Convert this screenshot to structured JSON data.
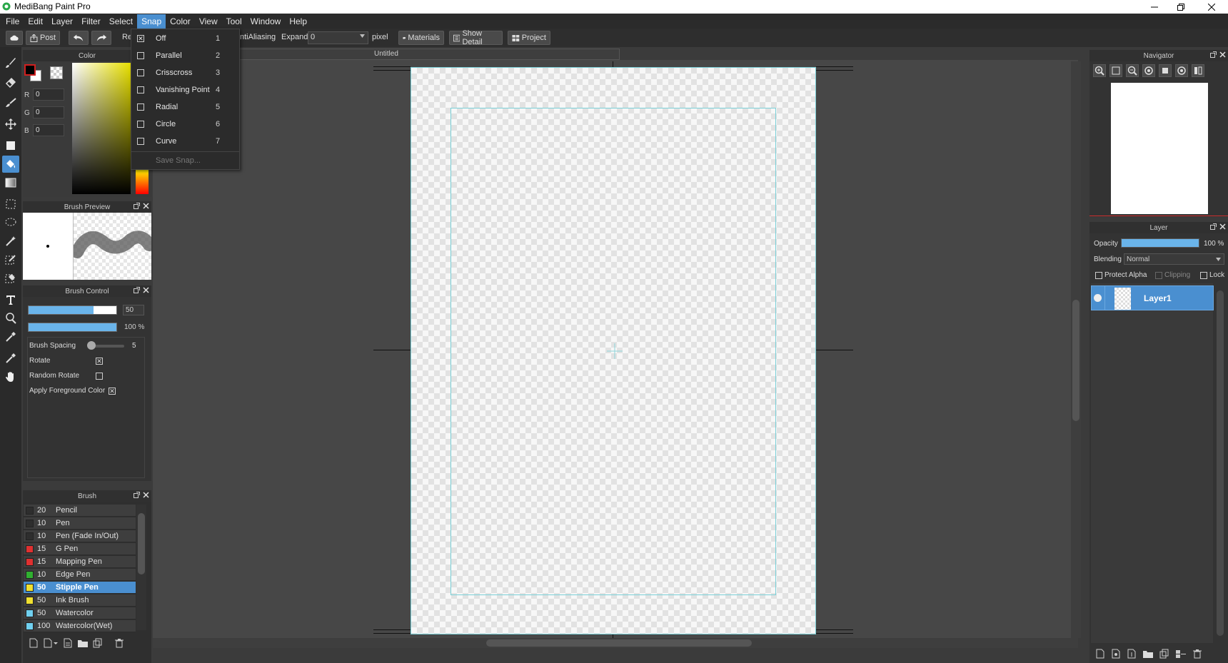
{
  "window": {
    "title": "MediBang Paint Pro"
  },
  "menubar": {
    "items": [
      "File",
      "Edit",
      "Layer",
      "Filter",
      "Select",
      "Snap",
      "Color",
      "View",
      "Tool",
      "Window",
      "Help"
    ],
    "active": "Snap"
  },
  "toolbar": {
    "post_label": "Post",
    "partial_label": "Re",
    "antialias_label": "ntiAliasing",
    "expand_label": "Expand",
    "expand_value": "0",
    "unit_label": "pixel",
    "materials_label": "Materials",
    "show_detail_label": "Show Detail",
    "project_label": "Project"
  },
  "snap_menu": {
    "items": [
      {
        "label": "Off",
        "key": "1",
        "checked": true
      },
      {
        "label": "Parallel",
        "key": "2",
        "checked": false
      },
      {
        "label": "Crisscross",
        "key": "3",
        "checked": false
      },
      {
        "label": "Vanishing Point",
        "key": "4",
        "checked": false
      },
      {
        "label": "Radial",
        "key": "5",
        "checked": false
      },
      {
        "label": "Circle",
        "key": "6",
        "checked": false
      },
      {
        "label": "Curve",
        "key": "7",
        "checked": false
      }
    ],
    "save_label": "Save Snap..."
  },
  "color_panel": {
    "title": "Color",
    "r_label": "R",
    "r_value": "0",
    "g_label": "G",
    "g_value": "0",
    "b_label": "B",
    "b_value": "0",
    "hue_color": "#e8e000"
  },
  "brush_preview": {
    "title": "Brush Preview"
  },
  "brush_control": {
    "title": "Brush Control",
    "size_value": "50",
    "size_fraction": 0.74,
    "opacity_value": "100 %",
    "opacity_fraction": 1.0,
    "spacing_label": "Brush Spacing",
    "spacing_value": "5",
    "rotate_label": "Rotate",
    "rotate_checked": true,
    "random_rotate_label": "Random Rotate",
    "random_rotate_checked": false,
    "apply_fg_label": "Apply Foreground Color",
    "apply_fg_checked": true
  },
  "brush_panel": {
    "title": "Brush",
    "items": [
      {
        "size": "20",
        "name": "Pencil",
        "color": "#2e2e2e"
      },
      {
        "size": "10",
        "name": "Pen",
        "color": "#2e2e2e"
      },
      {
        "size": "10",
        "name": "Pen (Fade In/Out)",
        "color": "#2e2e2e"
      },
      {
        "size": "15",
        "name": "G Pen",
        "color": "#e03030"
      },
      {
        "size": "15",
        "name": "Mapping Pen",
        "color": "#e03030"
      },
      {
        "size": "10",
        "name": "Edge Pen",
        "color": "#30b030"
      },
      {
        "size": "50",
        "name": "Stipple Pen",
        "color": "#f0e030",
        "selected": true
      },
      {
        "size": "50",
        "name": "Ink Brush",
        "color": "#f0e030"
      },
      {
        "size": "50",
        "name": "Watercolor",
        "color": "#70d0f0"
      },
      {
        "size": "100",
        "name": "Watercolor(Wet)",
        "color": "#70d0f0"
      }
    ]
  },
  "document": {
    "tab_title": "Untitled"
  },
  "navigator": {
    "title": "Navigator"
  },
  "layer_panel": {
    "title": "Layer",
    "opacity_label": "Opacity",
    "opacity_value": "100 %",
    "opacity_fraction": 1.0,
    "blending_label": "Blending",
    "blending_value": "Normal",
    "protect_alpha_label": "Protect Alpha",
    "clipping_label": "Clipping",
    "lock_label": "Lock",
    "layers": [
      {
        "name": "Layer1",
        "visible": true
      }
    ]
  },
  "colors": {
    "accent": "#4a8fd0"
  }
}
